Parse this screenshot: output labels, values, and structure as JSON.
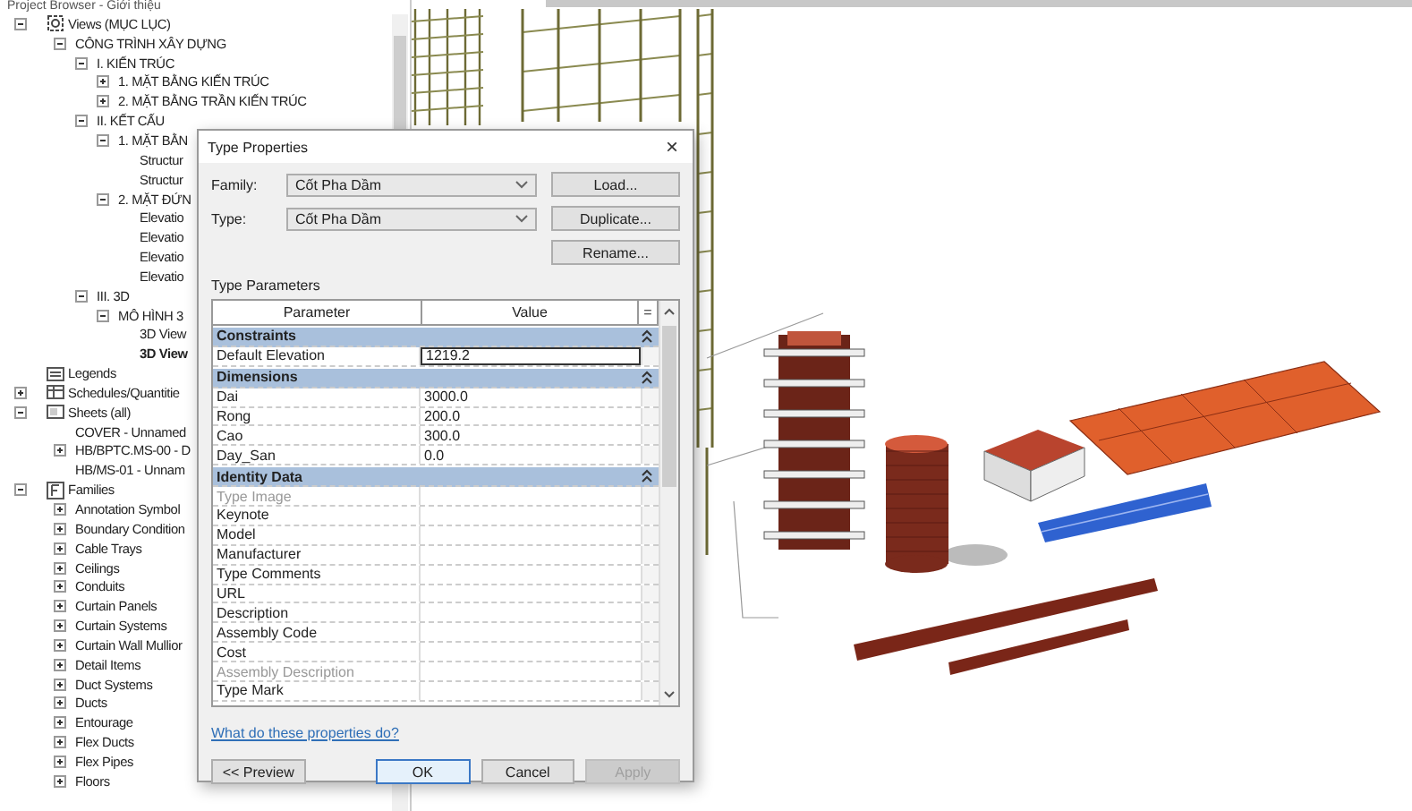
{
  "project_browser": {
    "title": "Project Browser - Giới thiệu",
    "tree": [
      {
        "label": "Views (MỤC LỤC)",
        "expanded": true,
        "selected": false,
        "children": [
          {
            "label": "CÔNG TRÌNH XÂY DỰNG",
            "expanded": true,
            "selected": false,
            "children": [
              {
                "label": "I. KIẾN TRÚC",
                "expanded": true,
                "selected": false,
                "children": [
                  {
                    "label": "1. MẶT BẰNG KIẾN TRÚC",
                    "expanded": false,
                    "selected": false
                  },
                  {
                    "label": "2. MẶT BẰNG TRẦN KIẾN TRÚC",
                    "expanded": false,
                    "selected": false
                  }
                ]
              },
              {
                "label": "II. KẾT CẤU",
                "expanded": true,
                "selected": false,
                "children": [
                  {
                    "label": "1. MẶT BẰN",
                    "expanded": true,
                    "selected": false,
                    "children": [
                      {
                        "label": "Structur",
                        "selected": false
                      },
                      {
                        "label": "Structur",
                        "selected": false
                      }
                    ]
                  },
                  {
                    "label": "2. MẶT ĐỨN",
                    "expanded": true,
                    "selected": false,
                    "children": [
                      {
                        "label": "Elevatio",
                        "selected": false
                      },
                      {
                        "label": "Elevatio",
                        "selected": false
                      },
                      {
                        "label": "Elevatio",
                        "selected": false
                      },
                      {
                        "label": "Elevatio",
                        "selected": false
                      }
                    ]
                  }
                ]
              },
              {
                "label": "III. 3D",
                "expanded": true,
                "selected": false,
                "children": [
                  {
                    "label": "MÔ HÌNH 3",
                    "expanded": true,
                    "selected": false,
                    "children": [
                      {
                        "label": "3D View",
                        "selected": false
                      },
                      {
                        "label": "3D View",
                        "selected": true
                      }
                    ]
                  }
                ]
              }
            ]
          }
        ]
      },
      {
        "label": "Legends",
        "selected": false
      },
      {
        "label": "Schedules/Quantitie",
        "expanded": false,
        "selected": false
      },
      {
        "label": "Sheets (all)",
        "expanded": true,
        "selected": false,
        "children": [
          {
            "label": "COVER - Unnamed",
            "selected": false
          },
          {
            "label": "HB/BPTC.MS-00 - D",
            "expanded": false,
            "selected": false
          },
          {
            "label": "HB/MS-01 - Unnam",
            "selected": false
          }
        ]
      },
      {
        "label": "Families",
        "expanded": true,
        "selected": false,
        "children": [
          {
            "label": "Annotation Symbol",
            "expanded": false,
            "selected": false
          },
          {
            "label": "Boundary Condition",
            "expanded": false,
            "selected": false
          },
          {
            "label": "Cable Trays",
            "expanded": false,
            "selected": false
          },
          {
            "label": "Ceilings",
            "expanded": false,
            "selected": false
          },
          {
            "label": "Conduits",
            "expanded": false,
            "selected": false
          },
          {
            "label": "Curtain Panels",
            "expanded": false,
            "selected": false
          },
          {
            "label": "Curtain Systems",
            "expanded": false,
            "selected": false
          },
          {
            "label": "Curtain Wall Mullior",
            "expanded": false,
            "selected": false
          },
          {
            "label": "Detail Items",
            "expanded": false,
            "selected": false
          },
          {
            "label": "Duct Systems",
            "expanded": false,
            "selected": false
          },
          {
            "label": "Ducts",
            "expanded": false,
            "selected": false
          },
          {
            "label": "Entourage",
            "expanded": false,
            "selected": false
          },
          {
            "label": "Flex Ducts",
            "expanded": false,
            "selected": false
          },
          {
            "label": "Flex Pipes",
            "expanded": false,
            "selected": false
          },
          {
            "label": "Floors",
            "expanded": false,
            "selected": false
          }
        ]
      }
    ]
  },
  "dialog": {
    "title": "Type Properties",
    "close": "×",
    "fields": [
      {
        "label": "Family:",
        "value": "Cốt Pha Dầm"
      },
      {
        "label": "Type:",
        "value": "Cốt Pha Dầm"
      }
    ],
    "side_buttons": [
      "Load...",
      "Duplicate...",
      "Rename..."
    ],
    "section_label": "Type Parameters",
    "table": {
      "columns": [
        "Parameter",
        "Value"
      ],
      "column_3": "=",
      "rows": [
        {
          "kind": "group",
          "label": "Constraints",
          "expanded": true
        },
        {
          "kind": "param",
          "name": "Default Elevation",
          "value": "1219.2",
          "disabled": false,
          "editing": true
        },
        {
          "kind": "group",
          "label": "Dimensions",
          "expanded": true
        },
        {
          "kind": "param",
          "name": "Dai",
          "value": "3000.0",
          "disabled": false,
          "editing": false
        },
        {
          "kind": "param",
          "name": "Rong",
          "value": "200.0",
          "disabled": false,
          "editing": false
        },
        {
          "kind": "param",
          "name": "Cao",
          "value": "300.0",
          "disabled": false,
          "editing": false
        },
        {
          "kind": "param",
          "name": "Day_San",
          "value": "0.0",
          "disabled": false,
          "editing": false
        },
        {
          "kind": "group",
          "label": "Identity Data",
          "expanded": true
        },
        {
          "kind": "param",
          "name": "Type Image",
          "disabled": true,
          "editing": false
        },
        {
          "kind": "param",
          "name": "Keynote",
          "disabled": false,
          "editing": false
        },
        {
          "kind": "param",
          "name": "Model",
          "disabled": false,
          "editing": false
        },
        {
          "kind": "param",
          "name": "Manufacturer",
          "disabled": false,
          "editing": false
        },
        {
          "kind": "param",
          "name": "Type Comments",
          "disabled": false,
          "editing": false
        },
        {
          "kind": "param",
          "name": "URL",
          "disabled": false,
          "editing": false
        },
        {
          "kind": "param",
          "name": "Description",
          "disabled": false,
          "editing": false
        },
        {
          "kind": "param",
          "name": "Assembly Code",
          "disabled": false,
          "editing": false
        },
        {
          "kind": "param",
          "name": "Cost",
          "disabled": false,
          "editing": false
        },
        {
          "kind": "param",
          "name": "Assembly Description",
          "disabled": true,
          "editing": false
        },
        {
          "kind": "param",
          "name": "Type Mark",
          "disabled": false,
          "editing": false
        }
      ]
    },
    "help_link": "What do these properties do?",
    "buttons": [
      {
        "label": "<< Preview",
        "disabled": false,
        "focused": false
      },
      {
        "label": "OK",
        "disabled": false,
        "focused": true
      },
      {
        "label": "Cancel",
        "disabled": false,
        "focused": false
      },
      {
        "label": "Apply",
        "disabled": true,
        "focused": false
      }
    ]
  }
}
